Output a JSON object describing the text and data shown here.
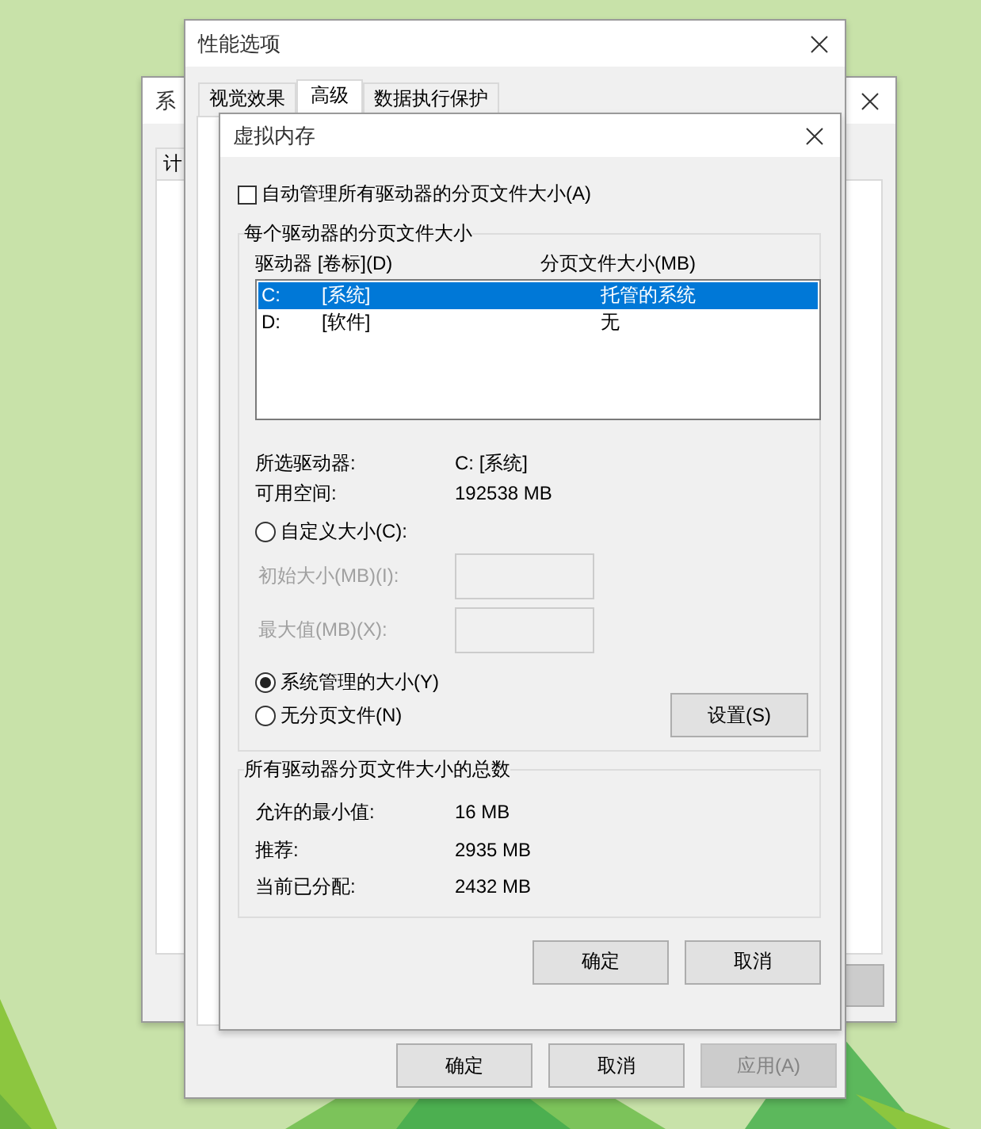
{
  "system_properties_window": {
    "title": "系",
    "tabs": [
      {
        "label": "计",
        "selected": false
      }
    ]
  },
  "performance_options_window": {
    "title": "性能选项",
    "tabs": [
      {
        "label": "视觉效果",
        "selected": false
      },
      {
        "label": "高级",
        "selected": true
      },
      {
        "label": "数据执行保护",
        "selected": false
      }
    ],
    "buttons": [
      {
        "label": "确定",
        "disabled": false
      },
      {
        "label": "取消",
        "disabled": false
      },
      {
        "label": "应用(A)",
        "disabled": true
      }
    ]
  },
  "virtual_memory_dialog": {
    "title": "虚拟内存",
    "auto_manage": {
      "label": "自动管理所有驱动器的分页文件大小(A)",
      "checked": false
    },
    "per_drive_group": {
      "title": "每个驱动器的分页文件大小",
      "columns": [
        "驱动器 [卷标](D)",
        "分页文件大小(MB)"
      ],
      "rows": [
        {
          "drive": "C:",
          "label": "[系统]",
          "size": "托管的系统",
          "selected": true
        },
        {
          "drive": "D:",
          "label": "[软件]",
          "size": "无",
          "selected": false
        }
      ],
      "info": [
        {
          "label": "所选驱动器:",
          "value": "C:  [系统]"
        },
        {
          "label": "可用空间:",
          "value": "192538 MB"
        }
      ],
      "options": [
        {
          "label": "自定义大小(C):",
          "selected": false
        },
        {
          "label": "系统管理的大小(Y)",
          "selected": true
        },
        {
          "label": "无分页文件(N)",
          "selected": false
        }
      ],
      "fields": [
        {
          "label": "初始大小(MB)(I):",
          "disabled": true
        },
        {
          "label": "最大值(MB)(X):",
          "disabled": true
        }
      ],
      "set_button": "设置(S)"
    },
    "totals_group": {
      "title": "所有驱动器分页文件大小的总数",
      "rows": [
        {
          "label": "允许的最小值:",
          "value": "16 MB"
        },
        {
          "label": "推荐:",
          "value": "2935 MB"
        },
        {
          "label": "当前已分配:",
          "value": "2432 MB"
        }
      ]
    },
    "buttons": [
      {
        "label": "确定"
      },
      {
        "label": "取消"
      }
    ]
  }
}
